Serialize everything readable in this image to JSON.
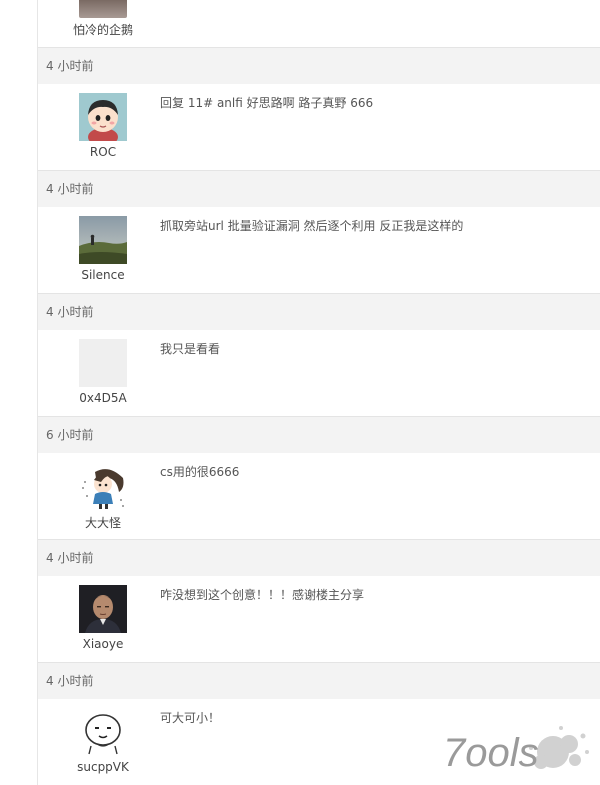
{
  "top_user": {
    "name": "怕冷的企鹅"
  },
  "comments": [
    {
      "time": "4 小时前",
      "user": "ROC",
      "content": "回复 11# anlfi 好思路啊 路子真野 666",
      "avatar": "cartoon-boy-avatar"
    },
    {
      "time": "4 小时前",
      "user": "Silence",
      "content": "抓取旁站url 批量验证漏洞 然后逐个利用 反正我是这样的",
      "avatar": "landscape-photo-avatar"
    },
    {
      "time": "4 小时前",
      "user": "0x4D5A",
      "content": "我只是看看",
      "avatar": "default-avatar"
    },
    {
      "time": "6 小时前",
      "user": "大大怪",
      "content": "cs用的很6666",
      "avatar": "anime-girl-avatar"
    },
    {
      "time": "4 小时前",
      "user": "Xiaoye",
      "content": "咋没想到这个创意！！！感谢楼主分享",
      "avatar": "man-photo-avatar"
    },
    {
      "time": "4 小时前",
      "user": "sucppVK",
      "content": "可大可小！",
      "avatar": "sketch-face-avatar"
    }
  ],
  "watermark": {
    "text": "7ools"
  }
}
